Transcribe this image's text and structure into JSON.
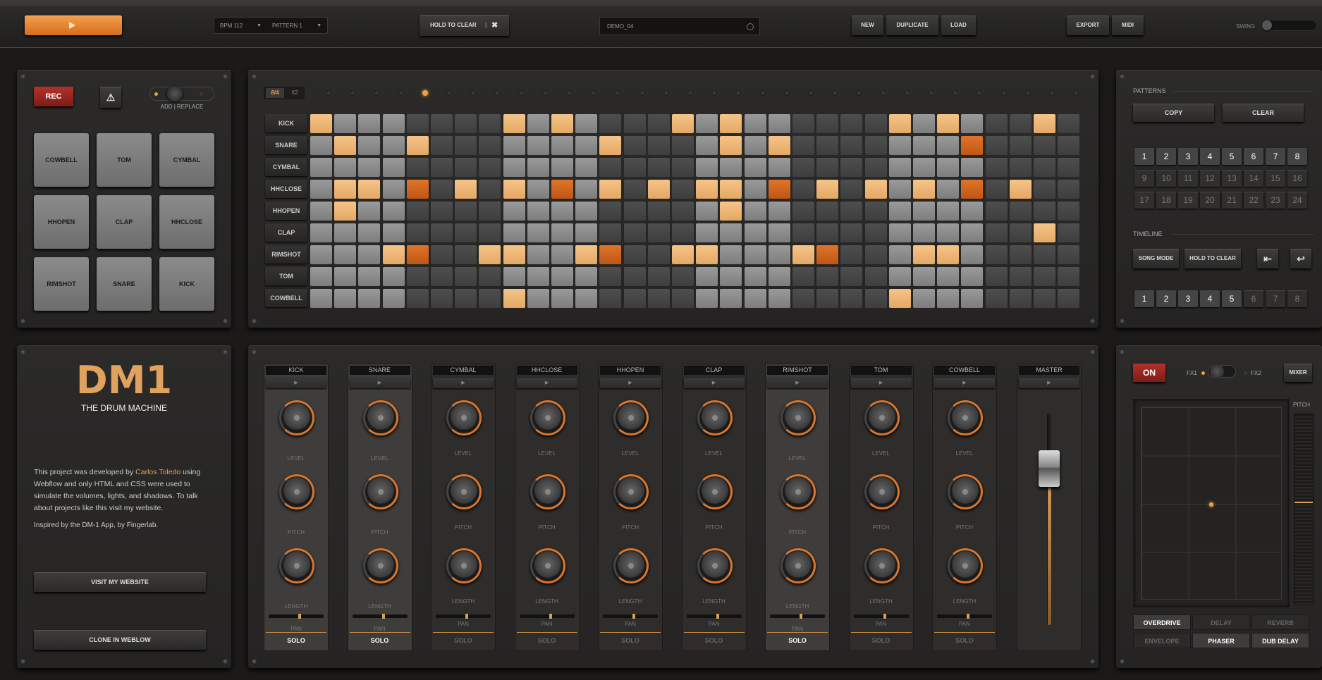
{
  "topbar": {
    "bpm": "BPM 112",
    "pattern": "PATTERN 1",
    "hold_to_clear": "HOLD TO CLEAR",
    "song_name": "DEMO_04",
    "new": "NEW",
    "duplicate": "DUPLICATE",
    "load": "LOAD",
    "export": "EXPORT",
    "midi": "MIDI",
    "swing": "SWING"
  },
  "pads": {
    "rec": "REC",
    "add_replace": "ADD | REPLACE",
    "items": [
      "COWBELL",
      "TOM",
      "CYMBAL",
      "HHOPEN",
      "CLAP",
      "HHCLOSE",
      "RIMSHOT",
      "SNARE",
      "KICK"
    ]
  },
  "sequencer": {
    "meter": "8/4",
    "mult": "X2",
    "active_led": 4,
    "rows": [
      {
        "name": "KICK",
        "steps": "1000000010100001010000001010001"
      },
      {
        "name": "SNARE",
        "steps": "0100100000001000010100000002000"
      },
      {
        "name": "CYMBAL",
        "steps": "0000000000000000000000000000000"
      },
      {
        "name": "HHCLOSE",
        "steps": "0110201010201010110201010102010"
      },
      {
        "name": "HHOPEN",
        "steps": "0100000000000000010000000000000"
      },
      {
        "name": "CLAP",
        "steps": "0000000000000000000000000000001"
      },
      {
        "name": "RIMSHOT",
        "steps": "0001200110012001100012000110000"
      },
      {
        "name": "TOM",
        "steps": "0000000000000000000000000000000"
      },
      {
        "name": "COWBELL",
        "steps": "0000000010000000000000001000000"
      }
    ]
  },
  "patterns": {
    "title": "PATTERNS",
    "copy": "COPY",
    "clear": "CLEAR",
    "numbers": [
      "1",
      "2",
      "3",
      "4",
      "5",
      "6",
      "7",
      "8",
      "9",
      "10",
      "11",
      "12",
      "13",
      "14",
      "15",
      "16",
      "17",
      "18",
      "19",
      "20",
      "21",
      "22",
      "23",
      "24"
    ],
    "timeline_title": "TIMELINE",
    "song_mode": "SONG MODE",
    "hold_to_clear": "HOLD TO CLEAR",
    "timeline": [
      "1",
      "2",
      "3",
      "4",
      "5",
      "6",
      "7",
      "8"
    ]
  },
  "info": {
    "title": "DM1",
    "subtitle": "THE DRUM MACHINE",
    "text_a": "This project was developed by ",
    "author": "Carlos Toledo",
    "text_b": " using Webflow and only HTML and CSS were used to simulate the volumes, lights, and shadows. To talk about projects like this visit my website.",
    "inspired": "Inspired by the DM-1 App, by Fingerlab.",
    "visit": "VISIT MY WEBSITE",
    "clone": "CLONE IN WEBLOW"
  },
  "mixer": {
    "channels": [
      {
        "name": "KICK",
        "solo": true
      },
      {
        "name": "SNARE",
        "solo": true
      },
      {
        "name": "CYMBAL",
        "solo": false
      },
      {
        "name": "HHCLOSE",
        "solo": false
      },
      {
        "name": "HHOPEN",
        "solo": false
      },
      {
        "name": "CLAP",
        "solo": false
      },
      {
        "name": "RIMSHOT",
        "solo": true
      },
      {
        "name": "TOM",
        "solo": false
      },
      {
        "name": "COWBELL",
        "solo": false
      }
    ],
    "level": "LEVEL",
    "pitch": "PITCH",
    "length": "LENGTH",
    "pan": "PAN",
    "solo": "SOLO",
    "master": "MASTER"
  },
  "fx": {
    "on": "ON",
    "fx1": "FX1",
    "fx2": "FX2",
    "mixer": "MIXER",
    "pitch": "PITCH",
    "buttons": [
      {
        "label": "OVERDRIVE",
        "on": true
      },
      {
        "label": "DELAY",
        "on": false
      },
      {
        "label": "REVERB",
        "on": false
      },
      {
        "label": "ENVELOPE",
        "on": false
      },
      {
        "label": "PHASER",
        "on": true
      },
      {
        "label": "DUB DELAY",
        "on": true
      }
    ]
  },
  "colors": {
    "accent": "#d9752b",
    "light_orange": "#f0b878",
    "dark_orange": "#d9661e"
  }
}
